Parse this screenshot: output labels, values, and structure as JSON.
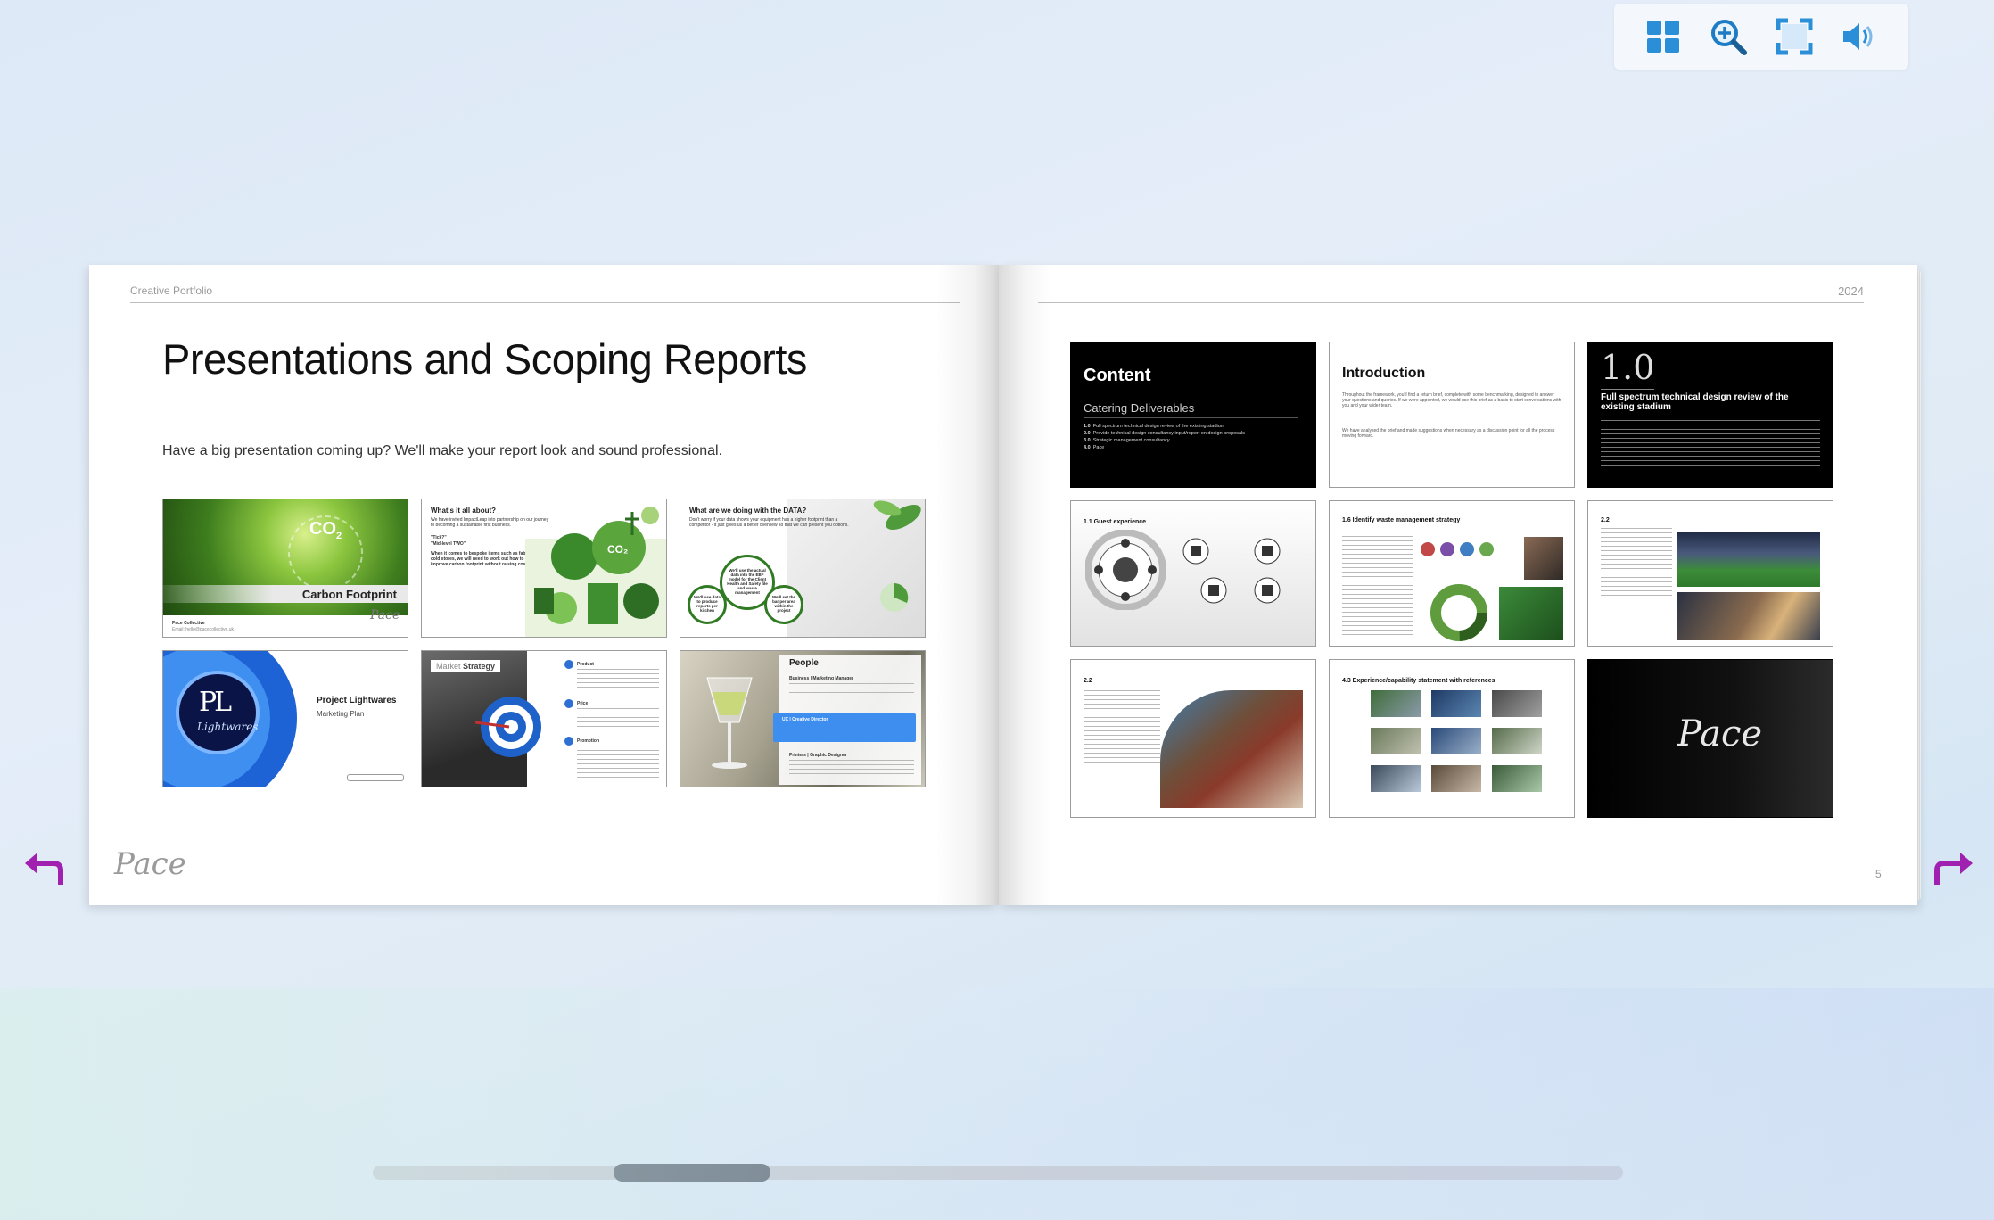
{
  "toolbar": {
    "icons": [
      "grid-icon",
      "zoom-in-icon",
      "fullscreen-icon",
      "speaker-icon"
    ],
    "accent": "#2b8fd8"
  },
  "nav": {
    "arrow_color": "#a020b0"
  },
  "left_page": {
    "header": "Creative Portfolio",
    "title": "Presentations and Scoping Reports",
    "subtitle": "Have a big presentation coming up? We'll make your report look and sound professional.",
    "thumbnails": [
      {
        "title": "Carbon Footprint",
        "formula": "CO",
        "subscript": "2",
        "footer_name": "Pace Collective",
        "footer_email": "Email: hello@pacecollective.uk"
      },
      {
        "title": "What's it all about?",
        "body": "We have invited ImpactLeap into partnership on our journey to becoming a sustainable first business.",
        "quote1": "\"Tick?\"",
        "quote2": "\"Mid-level TWO\"",
        "body2": "When it comes to bespoke items such as fabs and cold stores, we will need to work out how to improve carbon footprint without raising costs."
      },
      {
        "title": "What are we doing with the DATA?",
        "body": "Don't worry if your data shows your equipment has a higher footprint than a competitor - it just gives us a better overview so that we can present you options.",
        "circle1": "We'll use data to produce reports per kitchen",
        "circle2": "We'll use the actual data into the EBF model for the Client Health and Safety file and waste management",
        "circle3": "We'll set the bar per area within the project"
      },
      {
        "title": "Project Lightwares",
        "subtitle": "Marketing Plan",
        "logo_initials": "PL",
        "logo_script": "Lightwares"
      },
      {
        "title": "Strategy",
        "title_prefix": "Market",
        "items": [
          "Product",
          "Price",
          "Promotion"
        ]
      },
      {
        "title": "People",
        "section1": "Business | Marketing Manager",
        "highlight": "UX | Creative Director",
        "section2": "Printers | Graphic Designer"
      }
    ],
    "footer_logo": "Pace"
  },
  "right_page": {
    "header": "2024",
    "page_number": "5",
    "thumbnails": [
      {
        "title": "Content",
        "subtitle": "Catering Deliverables",
        "items": [
          {
            "num": "1.0",
            "text": "Full spectrum technical design review of the existing stadium"
          },
          {
            "num": "2.0",
            "text": "Provide technical design consultancy input/report on design proposals"
          },
          {
            "num": "3.0",
            "text": "Strategic management consultancy"
          },
          {
            "num": "4.0",
            "text": "Pace"
          }
        ]
      },
      {
        "title": "Introduction",
        "body": "Throughout the framework, you'll find a return brief, complete with some benchmarking, designed to answer your questions and queries. If we were appointed, we would use this brief as a basis to start conversations with you and your wider team.",
        "body2": "We have analysed the brief and made suggestions when necessary as a discussion point for all the process moving forward."
      },
      {
        "title": "1.0",
        "subtitle": "Full spectrum technical design review of the existing stadium"
      },
      {
        "title": "1.1 Guest experience"
      },
      {
        "title": "1.6 Identify waste management strategy"
      },
      {
        "title": "2.2"
      },
      {
        "title": "2.2"
      },
      {
        "title": "4.3 Experience/capability statement with references"
      },
      {
        "title": "Pace"
      }
    ]
  },
  "scrollbar": {
    "position": 0.22
  }
}
